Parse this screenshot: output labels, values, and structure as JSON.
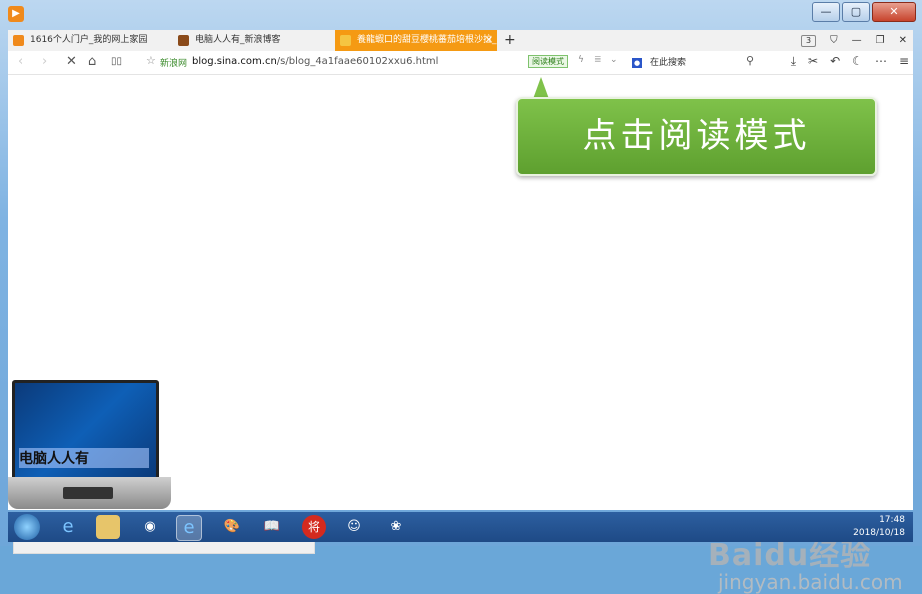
{
  "window": {
    "app_icon": "play-icon",
    "buttons": {
      "minimize": "—",
      "maximize": "▢",
      "close": "✕"
    }
  },
  "tabs": [
    {
      "label": "1616个人门户_我的网上家园",
      "favicon_color": "#f08a1c",
      "active": false
    },
    {
      "label": "电脑人人有_新浪博客",
      "favicon_color": "#8a4a1a",
      "active": false
    },
    {
      "label": "養龍蝦口的甜豆櫻桃蕃茄培根沙拉_E",
      "favicon_color": "#f5c542",
      "active": true
    }
  ],
  "tab_controls": {
    "new_tab": "+",
    "count": "3",
    "shirt": "👕",
    "min": "—",
    "restore": "❐",
    "close": "✕"
  },
  "navbar": {
    "back": "‹",
    "forward": "›",
    "stop": "✕",
    "home": "⌂",
    "reader": "▯▯",
    "star": "☆",
    "site_name": "新浪网",
    "url_domain": "blog.sina.com.cn",
    "url_path": "/s/blog_4a1faae60102xxu6.html",
    "read_mode": "阅读模式",
    "search_placeholder": "在此搜索"
  },
  "callout": {
    "text": "点击阅读模式",
    "color": "#6db33d"
  },
  "laptop": {
    "label": "电脑人人有"
  },
  "taskbar": {
    "clock_time": "17:48",
    "clock_date": "2018/10/18"
  },
  "watermark": {
    "brand": "Baidu经验",
    "url": "jingyan.baidu.com"
  }
}
